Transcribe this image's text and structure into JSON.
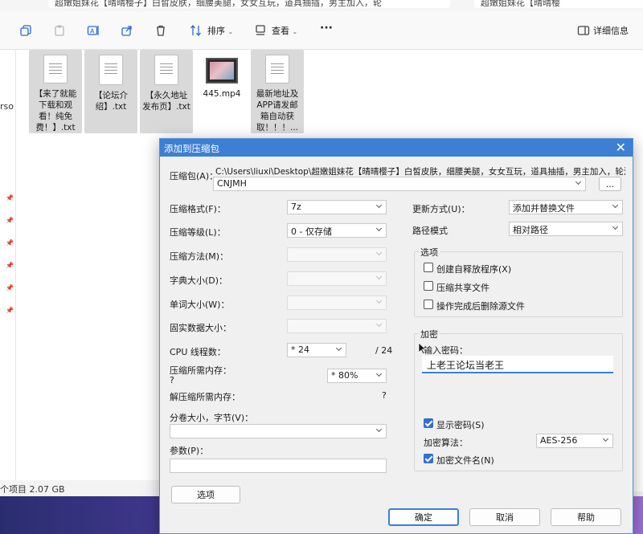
{
  "explorer": {
    "address_left": "超嫩姐妹花【晴晴樱子】白皙皮肤，细腰美腿，女女互玩，道具抽插，男主加入，轮",
    "address_right": "超嫩姐妹花【晴晴樱",
    "toolbar": {
      "sort_label": "排序",
      "view_label": "查看",
      "more_label": "···",
      "details_label": "详细信息"
    },
    "left_cut_text": "rso",
    "files": [
      {
        "name": "【来了就能下载和观看！纯免费！】.txt",
        "kind": "txt"
      },
      {
        "name": "【论坛介绍】.txt",
        "kind": "txt"
      },
      {
        "name": "【永久地址发布页】.txt",
        "kind": "txt"
      },
      {
        "name": "445.mp4",
        "kind": "video"
      },
      {
        "name": "最新地址及APP请发邮箱自动获取！！！...",
        "kind": "txt"
      }
    ],
    "status": "个项目 2.07 GB"
  },
  "dialog": {
    "title": "添加到压缩包",
    "archive_label": "压缩包(A)：",
    "archive_path": "C:\\Users\\liuxi\\Desktop\\超嫩姐妹花【晴晴樱子】白皙皮肤，细腰美腿，女女互玩，道具抽插，男主加入，轮流",
    "archive_name": "CNJMH",
    "browse_label": "...",
    "format_label": "压缩格式(F)：",
    "format_value": "7z",
    "level_label": "压缩等级(L)：",
    "level_value": "0 - 仅存储",
    "method_label": "压缩方法(M)：",
    "dict_label": "字典大小(D)：",
    "word_label": "单词大小(W)：",
    "solid_label": "固实数据大小：",
    "threads_label": "CPU 线程数：",
    "threads_value": "* 24",
    "threads_max": "/ 24",
    "mem_label": "压缩所需内存：",
    "mem_q": "?",
    "mem_value": "* 80%",
    "decomp_label": "解压缩所需内存：",
    "decomp_q": "?",
    "volume_label": "分卷大小，字节(V)：",
    "params_label": "参数(P)：",
    "options_button": "选项",
    "update_label": "更新方式(U)：",
    "update_value": "添加并替换文件",
    "path_label": "路径模式",
    "path_value": "相对路径",
    "options_group": "选项",
    "opt_sfx": "创建自释放程序(X)",
    "opt_shared": "压缩共享文件",
    "opt_delete": "操作完成后删除源文件",
    "enc_group": "加密",
    "enc_pw_label": "输入密码：",
    "enc_pw_value": "上老王论坛当老王",
    "enc_show": "显示密码(S)",
    "enc_method_label": "加密算法：",
    "enc_method_value": "AES-256",
    "enc_names": "加密文件名(N)",
    "ok": "确定",
    "cancel": "取消",
    "help": "帮助"
  }
}
